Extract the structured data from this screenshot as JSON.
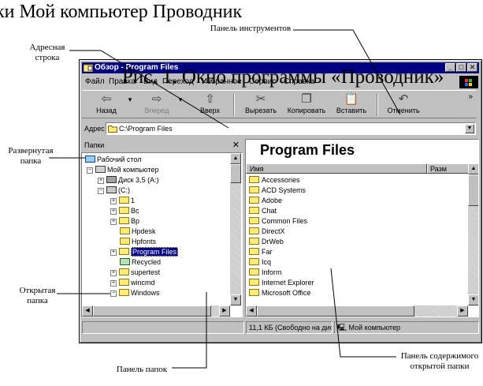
{
  "captions": {
    "top": "ки Мой компьютер Проводник",
    "figure": "Рис. 1. Окно программы «Проводник»"
  },
  "callouts": {
    "address_bar": "Адресная строка",
    "toolbar": "Панель инструментов",
    "expanded_folder": "Развернутая папка",
    "opened_folder": "Открытая папка",
    "folders_pane": "Панель папок",
    "contents_pane": "Панель содержимого открытой папки"
  },
  "window": {
    "title": "Обзор - Program Files",
    "controls": {
      "minimize": "_",
      "maximize": "□",
      "close": "✕"
    }
  },
  "menu": [
    "Файл",
    "Правка",
    "Вид",
    "Переход",
    "Избранное",
    "Сервис",
    "Справка"
  ],
  "toolbar": {
    "back": "Назад",
    "forward": "Вперед",
    "up": "Вверх",
    "cut": "Вырезать",
    "copy": "Копировать",
    "paste": "Вставить",
    "undo": "Отменить",
    "more": "»"
  },
  "address": {
    "label": "Адрес",
    "value": "C:\\Program Files"
  },
  "folder_pane": {
    "header": "Папки",
    "close": "✕",
    "tree": [
      {
        "label": "Рабочий стол",
        "expander": "",
        "icon": "desktop-icon"
      },
      {
        "label": "Мой компьютер",
        "expander": "−",
        "icon": "computer-icon"
      },
      {
        "label": "Диск 3,5 (A:)",
        "expander": "+",
        "icon": "floppy-icon"
      },
      {
        "label": "(C:)",
        "expander": "−",
        "icon": "harddisk-icon"
      },
      {
        "label": "1",
        "expander": "+",
        "icon": "folder-icon"
      },
      {
        "label": "Bc",
        "expander": "+",
        "icon": "folder-icon"
      },
      {
        "label": "Bp",
        "expander": "+",
        "icon": "folder-icon"
      },
      {
        "label": "Hpdesk",
        "expander": "",
        "icon": "folder-icon"
      },
      {
        "label": "Hpfonts",
        "expander": "",
        "icon": "folder-icon"
      },
      {
        "label": "Program Files",
        "expander": "+",
        "icon": "folder-open-icon",
        "selected": true
      },
      {
        "label": "Recycled",
        "expander": "",
        "icon": "recycle-bin-icon"
      },
      {
        "label": "supertest",
        "expander": "+",
        "icon": "folder-icon"
      },
      {
        "label": "wincmd",
        "expander": "+",
        "icon": "folder-icon"
      },
      {
        "label": "Windows",
        "expander": "−",
        "icon": "folder-icon"
      }
    ]
  },
  "content_pane": {
    "title": "Program Files",
    "columns": {
      "name": "Имя",
      "size": "Разм"
    },
    "items": [
      "Accessories",
      "ACD Systems",
      "Adobe",
      "Chat",
      "Common Files",
      "DirectX",
      "DrWeb",
      "Far",
      "Icq",
      "Inform",
      "Internet Explorer",
      "Microsoft Office"
    ]
  },
  "status": {
    "free": "11,1 КБ (Свободно на дис",
    "location": "Мой компьютер"
  },
  "colors": {
    "titlebar": "#000080",
    "face": "#c0c0c0",
    "folder": "#ffeb7a"
  }
}
